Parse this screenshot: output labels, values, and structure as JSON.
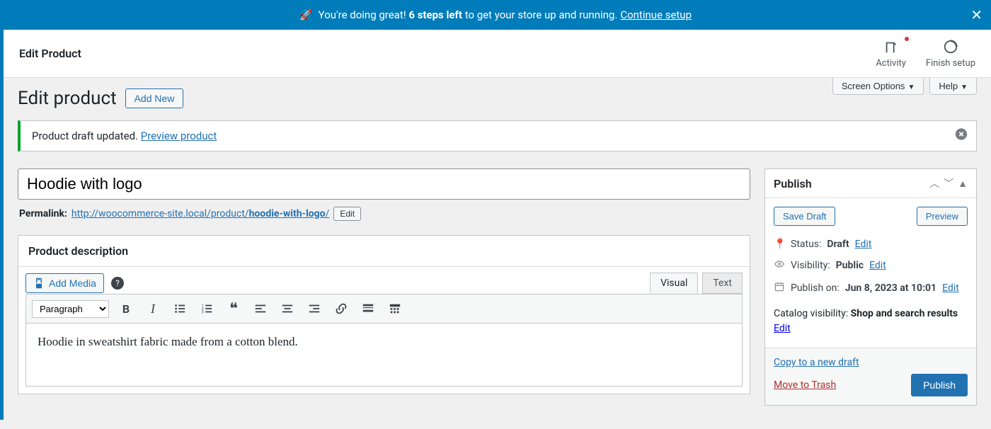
{
  "banner": {
    "prefix": "You're doing great!",
    "steps": "6 steps left",
    "suffix": "to get your store up and running.",
    "cta": "Continue setup"
  },
  "header": {
    "title": "Edit Product",
    "activity": "Activity",
    "finish_setup": "Finish setup"
  },
  "screen_options": "Screen Options",
  "help": "Help",
  "page_heading": "Edit product",
  "add_new": "Add New",
  "notice": {
    "text": "Product draft updated.",
    "link": "Preview product"
  },
  "product_title": "Hoodie with logo",
  "permalink": {
    "label": "Permalink:",
    "base": "http://woocommerce-site.local/product/",
    "slug": "hoodie-with-logo",
    "tail": "/",
    "edit": "Edit"
  },
  "desc_box": {
    "title": "Product description",
    "add_media": "Add Media",
    "visual": "Visual",
    "text": "Text",
    "paragraph": "Paragraph",
    "content": "Hoodie in sweatshirt fabric made from a cotton blend."
  },
  "publish": {
    "title": "Publish",
    "save_draft": "Save Draft",
    "preview": "Preview",
    "status_label": "Status:",
    "status_value": "Draft",
    "visibility_label": "Visibility:",
    "visibility_value": "Public",
    "publish_on_label": "Publish on:",
    "publish_on_value": "Jun 8, 2023 at 10:01",
    "catalog_label": "Catalog visibility:",
    "catalog_value": "Shop and search results",
    "edit": "Edit",
    "copy_draft": "Copy to a new draft",
    "trash": "Move to Trash",
    "publish_btn": "Publish"
  }
}
